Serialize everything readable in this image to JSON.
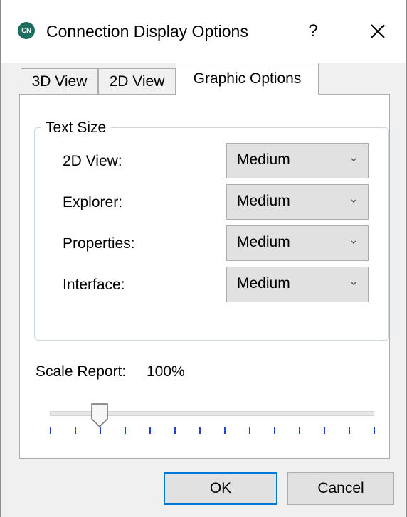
{
  "window": {
    "app_icon_text": "CN",
    "title": "Connection Display Options",
    "help_label": "?",
    "close_icon": "close-icon"
  },
  "tabs": [
    {
      "label": "3D View",
      "active": false
    },
    {
      "label": "2D View",
      "active": false
    },
    {
      "label": "Graphic Options",
      "active": true
    }
  ],
  "text_size": {
    "legend": "Text Size",
    "rows": [
      {
        "label": "2D View:",
        "value": "Medium"
      },
      {
        "label": "Explorer:",
        "value": "Medium"
      },
      {
        "label": "Properties:",
        "value": "Medium"
      },
      {
        "label": "Interface:",
        "value": "Medium"
      }
    ]
  },
  "scale": {
    "label": "Scale Report:",
    "value_text": "100%",
    "tick_count": 14,
    "thumb_tick_index": 2
  },
  "buttons": {
    "ok": "OK",
    "cancel": "Cancel"
  },
  "colors": {
    "accent": "#0078d7",
    "app_icon": "#1e6e60",
    "ticks": "#1f46c8"
  }
}
